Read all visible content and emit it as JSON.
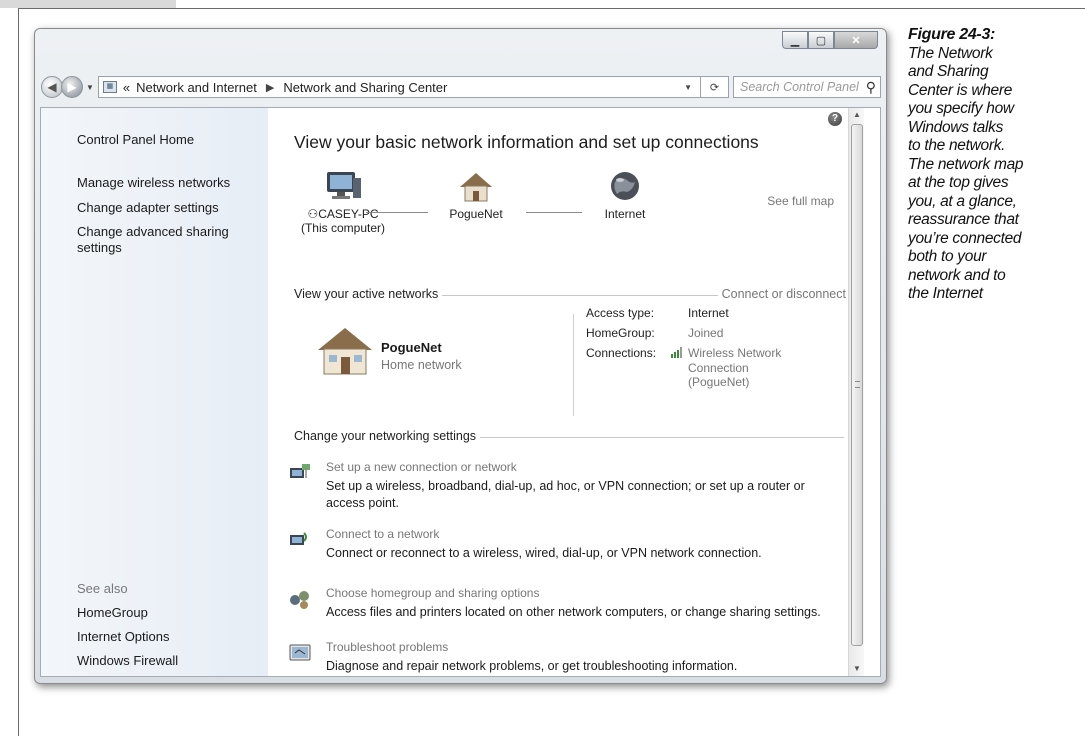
{
  "caption": {
    "title": "Figure 24-3:",
    "lines": [
      "The Network",
      "and Sharing",
      "Center is where",
      "you specify how",
      "Windows talks",
      "to the network.",
      "The network map",
      "at the top gives",
      "you, at a glance,",
      "reassurance that",
      "you’re connected",
      "both to your",
      "network and to",
      "the Internet"
    ]
  },
  "window": {
    "address": {
      "chevrons": "«",
      "crumb1": "Network and Internet",
      "crumb2": "Network and Sharing Center",
      "search_placeholder": "Search Control Panel"
    },
    "sidebar": {
      "home": "Control Panel Home",
      "links": [
        "Manage wireless networks",
        "Change adapter settings",
        "Change advanced sharing",
        "settings"
      ],
      "see_also_heading": "See also",
      "see_also": [
        "HomeGroup",
        "Internet Options",
        "Windows Firewall"
      ]
    },
    "main": {
      "title": "View your basic network information and set up connections",
      "see_full_map": "See full map",
      "map": {
        "computer": "CASEY-PC",
        "computer_sub": "(This computer)",
        "network": "PogueNet",
        "internet": "Internet"
      },
      "active_heading": "View your active networks",
      "connect_disconnect": "Connect or disconnect",
      "network_name": "PogueNet",
      "network_type": "Home network",
      "access_type_label": "Access type:",
      "access_type_value": "Internet",
      "homegroup_label": "HomeGroup:",
      "homegroup_value": "Joined",
      "connections_label": "Connections:",
      "connections_value": [
        "Wireless Network",
        "Connection",
        "(PogueNet)"
      ],
      "settings_heading": "Change your networking settings",
      "tasks": [
        {
          "link": "Set up a new connection or network",
          "desc": "Set up a wireless, broadband, dial-up, ad hoc, or VPN connection; or set up a router or access point."
        },
        {
          "link": "Connect to a network",
          "desc": "Connect or reconnect to a wireless, wired, dial-up, or VPN network connection."
        },
        {
          "link": "Choose homegroup and sharing options",
          "desc": "Access files and printers located on other network computers, or change sharing settings."
        },
        {
          "link": "Troubleshoot problems",
          "desc": "Diagnose and repair network problems, or get troubleshooting information."
        }
      ]
    }
  }
}
